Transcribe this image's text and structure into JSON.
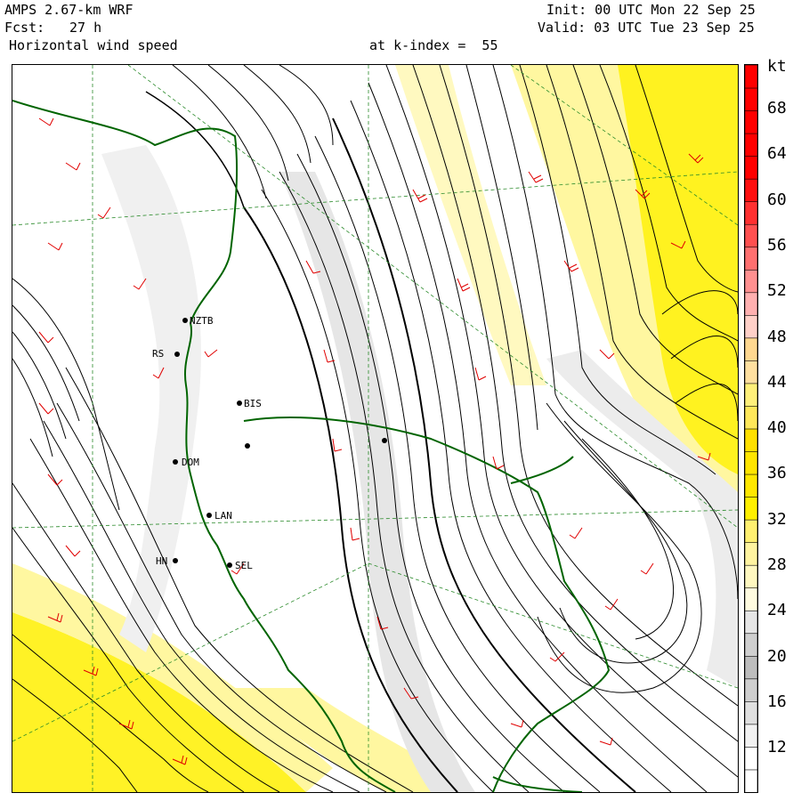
{
  "header": {
    "model": "AMPS 2.67-km WRF",
    "forecast_label": "Fcst:",
    "forecast_value": "27 h",
    "field": "Horizontal wind speed",
    "level": "at k-index =  55",
    "init": "Init: 00 UTC Mon 22 Sep 25",
    "valid": "Valid: 03 UTC Tue 23 Sep 25"
  },
  "colorbar": {
    "unit": "kt",
    "labels": [
      "68",
      "64",
      "60",
      "56",
      "52",
      "48",
      "44",
      "40",
      "36",
      "32",
      "28",
      "24",
      "20",
      "16",
      "12"
    ],
    "colors": [
      "#ffffff",
      "#e8e8e8",
      "#d3d3d3",
      "#bdbdbd",
      "#c8c8c8",
      "#fffde0",
      "#fff9b8",
      "#fff580",
      "#ffef40",
      "#fff000",
      "#fff000",
      "#ffef40",
      "#ffe8a0",
      "#ffd88a",
      "#ffc7c7",
      "#ff9a9a",
      "#ff6a6a",
      "#ff3a3a",
      "#ff0000"
    ],
    "accent_map_yellow": "#ffee00",
    "coast_color": "#006400",
    "barb_color": "#e00000"
  },
  "stations": [
    {
      "id": "NZTB"
    },
    {
      "id": "RS"
    },
    {
      "id": "BIS"
    },
    {
      "id": "DOM"
    },
    {
      "id": "LAN"
    },
    {
      "id": "HN"
    },
    {
      "id": "SEL"
    }
  ]
}
